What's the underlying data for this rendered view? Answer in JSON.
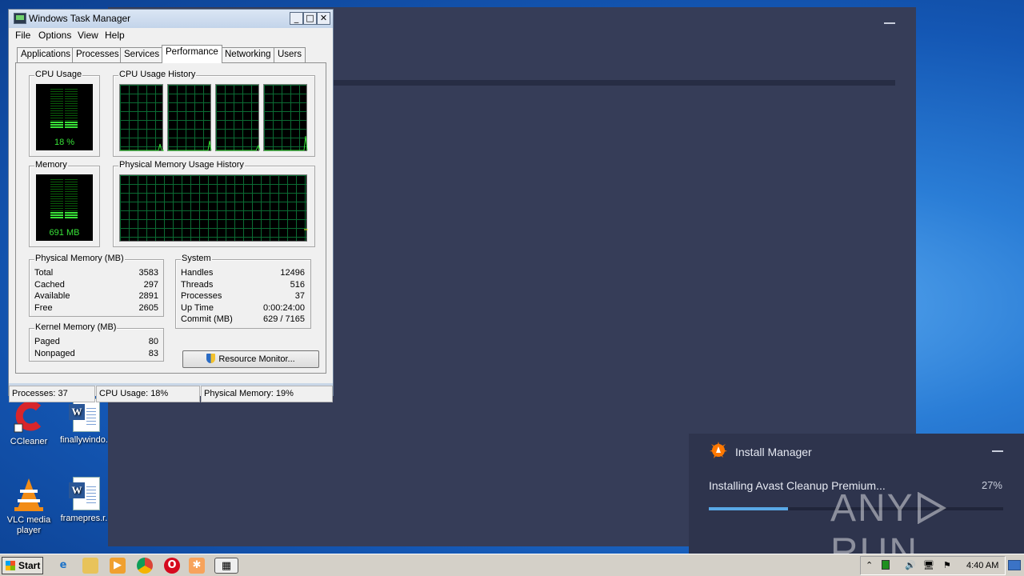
{
  "desktop": {
    "icons": [
      {
        "label": "CCleaner",
        "icon": "ccleaner-icon"
      },
      {
        "label": "finallywindo...",
        "icon": "word-document-icon"
      },
      {
        "label": "VLC media player",
        "icon": "vlc-icon"
      },
      {
        "label": "framepres.r...",
        "icon": "word-document-icon"
      }
    ]
  },
  "task_manager": {
    "title": "Windows Task Manager",
    "menu": [
      "File",
      "Options",
      "View",
      "Help"
    ],
    "tabs": [
      "Applications",
      "Processes",
      "Services",
      "Performance",
      "Networking",
      "Users"
    ],
    "active_tab": "Performance",
    "cpu_usage": {
      "label": "CPU Usage",
      "value": "18 %",
      "level": 0.18
    },
    "cpu_history_label": "CPU Usage History",
    "memory": {
      "label": "Memory",
      "value": "691 MB",
      "level": 0.19
    },
    "mem_history_label": "Physical Memory Usage History",
    "physical_memory": {
      "label": "Physical Memory (MB)",
      "rows": [
        {
          "k": "Total",
          "v": "3583"
        },
        {
          "k": "Cached",
          "v": "297"
        },
        {
          "k": "Available",
          "v": "2891"
        },
        {
          "k": "Free",
          "v": "2605"
        }
      ]
    },
    "kernel_memory": {
      "label": "Kernel Memory (MB)",
      "rows": [
        {
          "k": "Paged",
          "v": "80"
        },
        {
          "k": "Nonpaged",
          "v": "83"
        }
      ]
    },
    "system": {
      "label": "System",
      "rows": [
        {
          "k": "Handles",
          "v": "12496"
        },
        {
          "k": "Threads",
          "v": "516"
        },
        {
          "k": "Processes",
          "v": "37"
        },
        {
          "k": "Up Time",
          "v": "0:00:24:00"
        },
        {
          "k": "Commit (MB)",
          "v": "629 / 7165"
        }
      ]
    },
    "resource_monitor_button": "Resource Monitor...",
    "status": {
      "processes": "Processes: 37",
      "cpu": "CPU Usage: 18%",
      "memory": "Physical Memory: 19%"
    }
  },
  "install_manager": {
    "title": "Install Manager",
    "status": "Installing Avast Cleanup Premium...",
    "percent": "27%",
    "progress": 0.27,
    "logo_color": "#ff7800"
  },
  "watermark": {
    "left": "ANY",
    "right": "RUN"
  },
  "taskbar": {
    "start": "Start",
    "clock": "4:40 AM"
  },
  "colors": {
    "avast_bg": "#363d58",
    "meter_green": "#38e338",
    "progress_blue": "#59a8e6"
  }
}
